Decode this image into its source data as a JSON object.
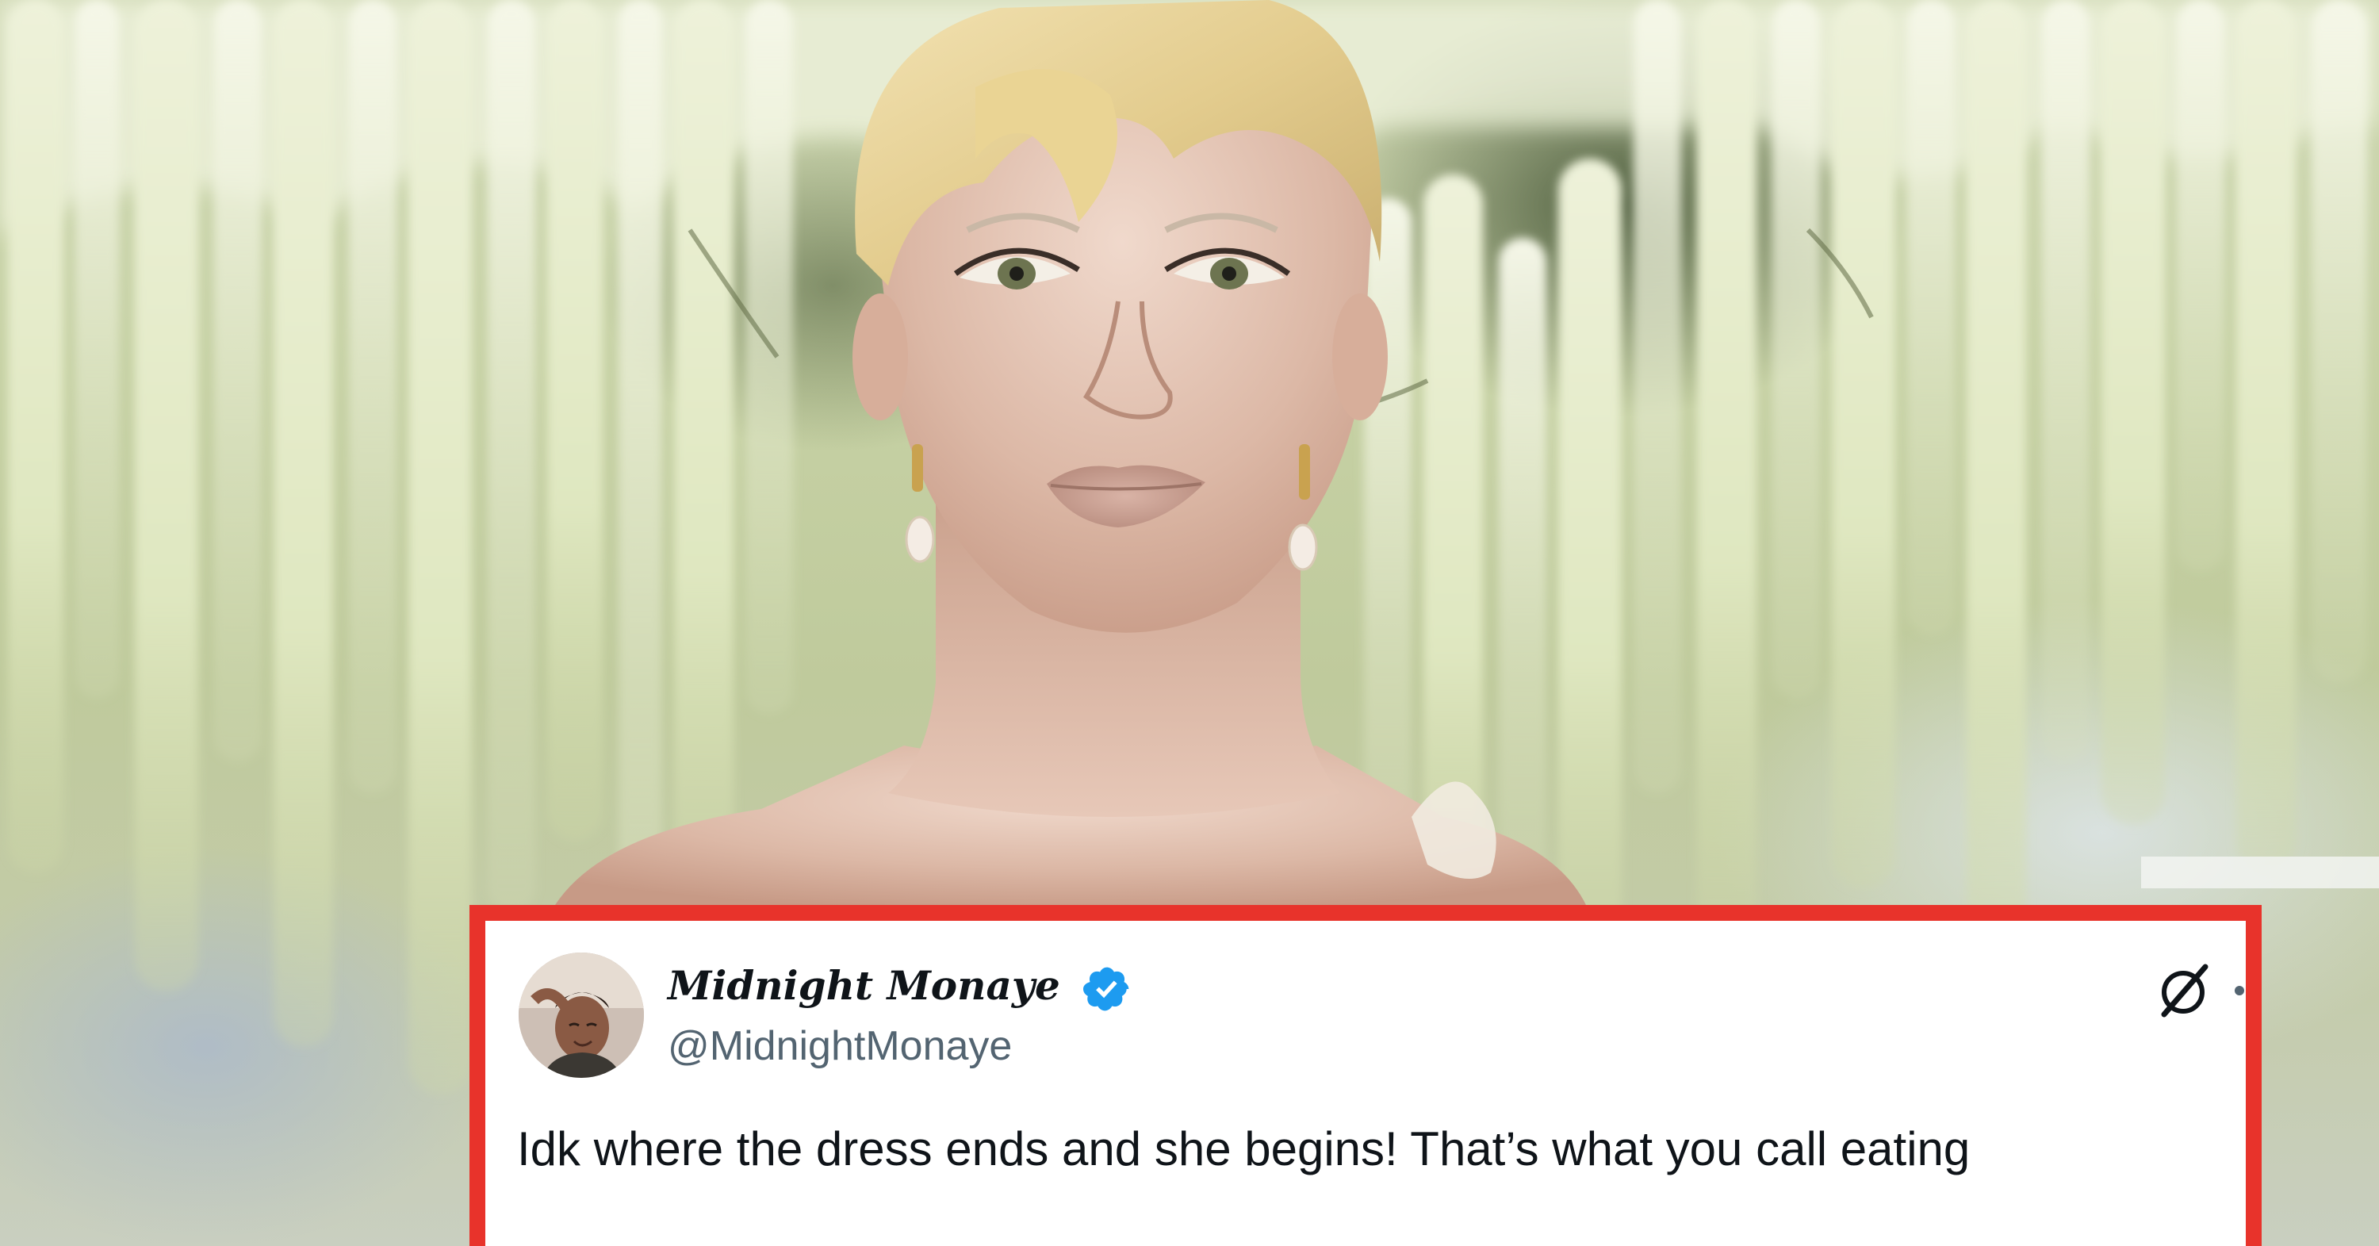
{
  "tweet": {
    "author_name": "Midnight Monaye",
    "author_handle": "@MidnightMonaye",
    "verified": true,
    "text": "Idk where the dress ends and she begins! That’s what you call eating",
    "platform_icon": "x-logo-icon",
    "menu_icon": "more-dot-icon"
  },
  "colors": {
    "frame_border": "#e8332b",
    "card_background": "#ffffff",
    "verified_blue": "#1d9bf0",
    "name_text": "#0f1419",
    "handle_text": "#536471"
  },
  "icons": {
    "verified": "verified-badge-icon",
    "avatar": "profile-avatar-icon"
  }
}
